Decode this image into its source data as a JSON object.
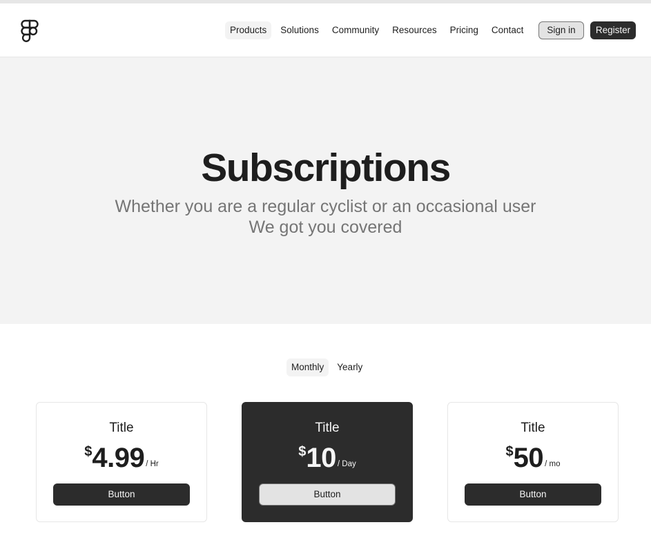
{
  "header": {
    "logo": "figma-logo",
    "nav": [
      {
        "label": "Products"
      },
      {
        "label": "Solutions"
      },
      {
        "label": "Community"
      },
      {
        "label": "Resources"
      },
      {
        "label": "Pricing"
      },
      {
        "label": "Contact"
      }
    ],
    "active_nav": "Products",
    "sign_in_label": "Sign in",
    "register_label": "Register"
  },
  "hero": {
    "title": "Subscriptions",
    "subtitle_line1": "Whether you are a regular cyclist or an occasional user",
    "subtitle_line2": "We got you covered"
  },
  "billing_toggle": {
    "options": [
      "Monthly",
      "Yearly"
    ],
    "selected": "Monthly"
  },
  "plans": [
    {
      "title": "Title",
      "currency": "$",
      "price": "4.99",
      "period": "/ Hr",
      "button_label": "Button"
    },
    {
      "title": "Title",
      "currency": "$",
      "price": "10",
      "period": "/ Day",
      "button_label": "Button"
    },
    {
      "title": "Title",
      "currency": "$",
      "price": "50",
      "period": "/ mo",
      "button_label": "Button"
    }
  ],
  "colors": {
    "primary": "#2c2c2c",
    "surface": "#f3f3f3",
    "text": "#1e1e1e",
    "muted_text": "#757575"
  }
}
